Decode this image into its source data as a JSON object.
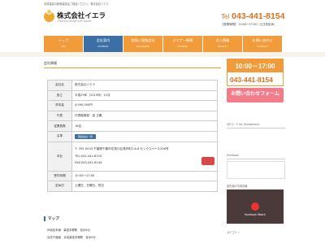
{
  "header": {
    "topline": "京成建設の新築建設はご相談ください。株式会社イエラ",
    "company_name": "株式会社イエラ",
    "tagline": "Your Exclusive Life Agent",
    "tel_prefix": "Tel",
    "tel": "043-441-8154",
    "hours": "【営業時間】 10:00～17:00（土日祝定休）"
  },
  "nav": [
    {
      "jp": "トップ",
      "en": "TOP"
    },
    {
      "jp": "会社案内",
      "en": "COMPANY"
    },
    {
      "jp": "取扱い保険会社",
      "en": "INSURANCE"
    },
    {
      "jp": "セミナー情報",
      "en": "SEMINAR"
    },
    {
      "jp": "求人情報",
      "en": "RECRUIT"
    },
    {
      "jp": "お問い合わせ",
      "en": "CONTACT"
    }
  ],
  "main": {
    "section_title": "会社情報",
    "rows": [
      {
        "k": "会社名",
        "v": "株式会社イエラ"
      },
      {
        "k": "設立",
        "v": "平成29年（2019年）11月"
      },
      {
        "k": "資本金",
        "v": "4,990,000円"
      },
      {
        "k": "代表",
        "v": "代表取締役　宮 正義"
      },
      {
        "k": "従業員数",
        "v": "16名"
      },
      {
        "k": "沿革",
        "v": "取扱い会社一覧"
      },
      {
        "k": "本社",
        "v": "〒 292-0033 千葉県千葉市花見川区長作町2-8-8 センクスペース206号"
      },
      {
        "k": "受付時間",
        "v": "10:00～17:00"
      },
      {
        "k": "定休日",
        "v": "土曜日、日曜日、祝日"
      }
    ],
    "address_tel": "TEL:043-441-8154",
    "address_fax": "FAX:043-441-8134",
    "map_button": "取扱会社一覧",
    "map_title": "マップ",
    "access1": "JR総武本線　幕張本郷駅　徒歩8分",
    "access2": "京成千葉線　京成幕張本郷駅　徒歩9分"
  },
  "aside": {
    "banner_hours": "10:00－17:00",
    "banner_tel": "043-441-8154",
    "banner_form": "お問い合わせフォーム",
    "qr_label": "QRコード for Smartphone",
    "fb_label": "Facebook",
    "video_label": "最先端の写真情報",
    "video_caption": "Facebook Watch",
    "cat_label": "カテゴリー"
  },
  "colors": {
    "accent": "#f29b3a",
    "nav_active": "#3c6fa6",
    "tel": "#e07020"
  }
}
